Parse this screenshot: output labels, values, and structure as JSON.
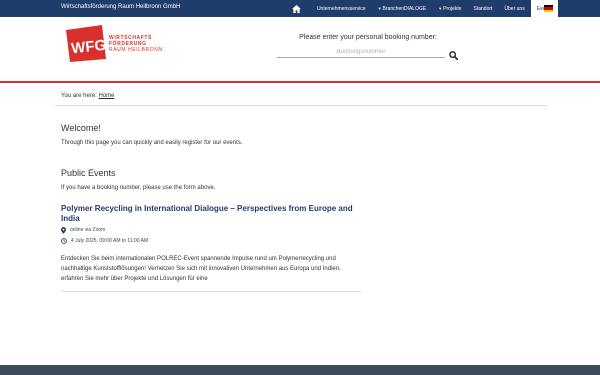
{
  "topbar": {
    "org_name": "Wirtschaftsförderung Raum Heilbronn GmbH",
    "nav": [
      {
        "label": "Unternehmensservice",
        "dropdown": false
      },
      {
        "label": "BranchenDIALOGE",
        "dropdown": true
      },
      {
        "label": "Projekte",
        "dropdown": true
      },
      {
        "label": "Standort",
        "dropdown": false
      },
      {
        "label": "Über uns",
        "dropdown": false
      },
      {
        "label": "Events",
        "dropdown": false,
        "active": true
      }
    ],
    "home_icon": "home-icon",
    "language_icon": "flag-de-icon"
  },
  "header": {
    "logo": {
      "mark": "WFG",
      "line1": "WIRTSCHAFTS",
      "line2": "FÖRDERUNG",
      "line3": "RAUM HEILBRONN"
    },
    "booking": {
      "label": "Please enter your personal booking number:",
      "placeholder": "Buchungsnummer",
      "value": "",
      "search_icon": "search-icon"
    }
  },
  "breadcrumb": {
    "prefix": "You are here:",
    "home": "Home"
  },
  "welcome": {
    "title": "Welcome!",
    "text": "Through this page you can quickly and easily register for our events."
  },
  "public_events": {
    "title": "Public Events",
    "text": "If you have a booking number, please use the form above.",
    "events": [
      {
        "title": "Polymer Recycling in International Dialogue – Perspectives from Europe and India",
        "location": "online via Zoom",
        "datetime": "4 July 2025, 09:00 AM to 11:00 AM",
        "description": "Entdecken Sie beim internationalen POLREC-Event spannende Impulse rund um Polymerrecycling und nachhaltige Kunststofflösungen! Vernetzen Sie sich mit innovativen Unternehmen aus Europa und Indien, erfahren Sie mehr über Projekte und Lösungen für eine"
      }
    ]
  },
  "colors": {
    "navy": "#1f3d6b",
    "accent_red": "#d9302b",
    "footer": "#3d4a5a"
  }
}
